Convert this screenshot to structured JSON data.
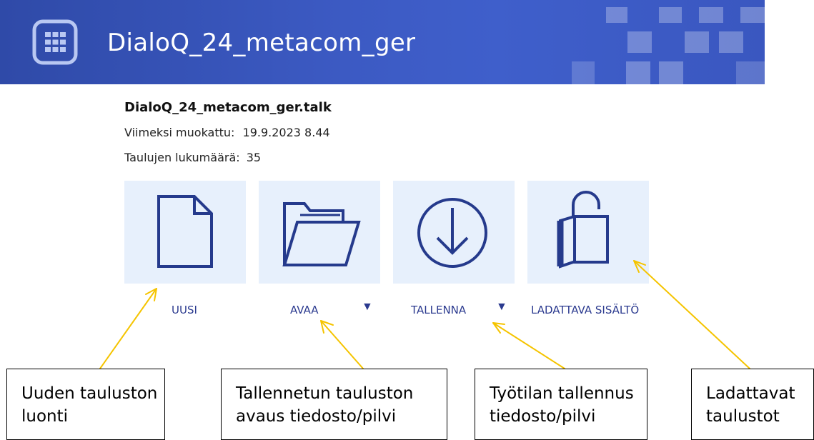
{
  "header": {
    "title": "DialoQ_24_metacom_ger",
    "icon": "grid-icon"
  },
  "file": {
    "name": "DialoQ_24_metacom_ger.talk",
    "modified_label": "Viimeksi muokattu:",
    "modified_value": "19.9.2023 8.44",
    "count_label": "Taulujen lukumäärä:",
    "count_value": "35"
  },
  "actions": [
    {
      "label": "UUSI",
      "icon": "new-document-icon"
    },
    {
      "label": "AVAA",
      "icon": "folder-icon",
      "dropdown": "▼"
    },
    {
      "label": "TALLENNA",
      "icon": "download-icon",
      "dropdown": "▼"
    },
    {
      "label": "LADATTAVA SISÄLTÖ",
      "icon": "shopping-bag-icon"
    }
  ],
  "callouts": [
    {
      "line1": "Uuden tauluston",
      "line2": "luonti"
    },
    {
      "line1": "Tallennetun tauluston",
      "line2": "avaus tiedosto/pilvi"
    },
    {
      "line1": "Työtilan tallennus",
      "line2": "tiedosto/pilvi"
    },
    {
      "line1": "Ladattavat",
      "line2": "taulustot"
    }
  ],
  "colors": {
    "header": "#3c5ac3",
    "tile": "#e7f0fc",
    "icon_stroke": "#253a8c",
    "label": "#2b3a8f",
    "arrow": "#f5c400"
  }
}
